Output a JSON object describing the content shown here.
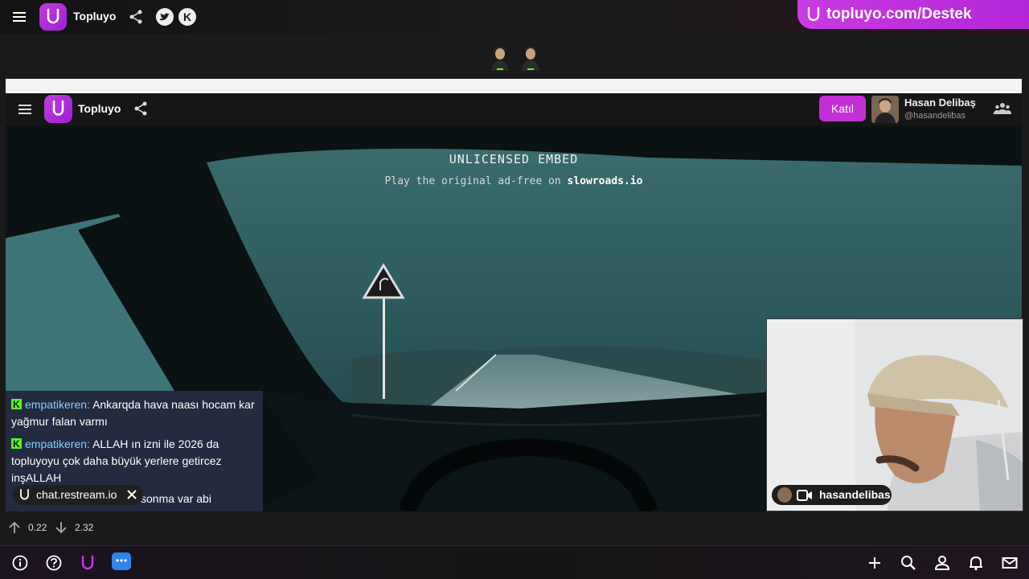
{
  "topbar": {
    "brand": "Topluyo",
    "pill_text": "topluyo.com/Destek",
    "kick_letter": "K"
  },
  "inner_bar": {
    "brand": "Topluyo",
    "join_label": "Katıl",
    "host_name": "Hasan Delibaş",
    "host_handle": "@hasandelibas"
  },
  "embed": {
    "title": "UNLICENSED EMBED",
    "sub_prefix": "Play the original ad-free on ",
    "sub_site": "slowroads.io"
  },
  "chat": {
    "messages": [
      {
        "user": "empatikeren",
        "text": "Ankarqda hava naası hocam kar yağmur falan varmı"
      },
      {
        "user": "empatikeren",
        "text": "ALLAH ın izni ile 2026 da topluyoyu çok daha büyük yerlere getircez inşALLAH"
      }
    ],
    "partial_message": "sonma var abi",
    "toast": "chat.restream.io"
  },
  "camera": {
    "label": "hasandelibas"
  },
  "stats": {
    "upload": "0.22",
    "download": "2.32"
  },
  "colors": {
    "brand": "#c13de0",
    "join": "#c331d6",
    "chat_bg": "#282d46",
    "username": "#7fd0ff",
    "kick": "#53fc18"
  },
  "icons": [
    "menu-icon",
    "share-icon",
    "twitter-icon",
    "kick-icon",
    "people-icon",
    "info-icon",
    "help-icon",
    "chat-icon",
    "plus-icon",
    "search-icon",
    "user-icon",
    "bell-icon",
    "mail-icon",
    "video-camera-icon",
    "close-icon",
    "arrow-up-icon",
    "arrow-down-icon"
  ]
}
